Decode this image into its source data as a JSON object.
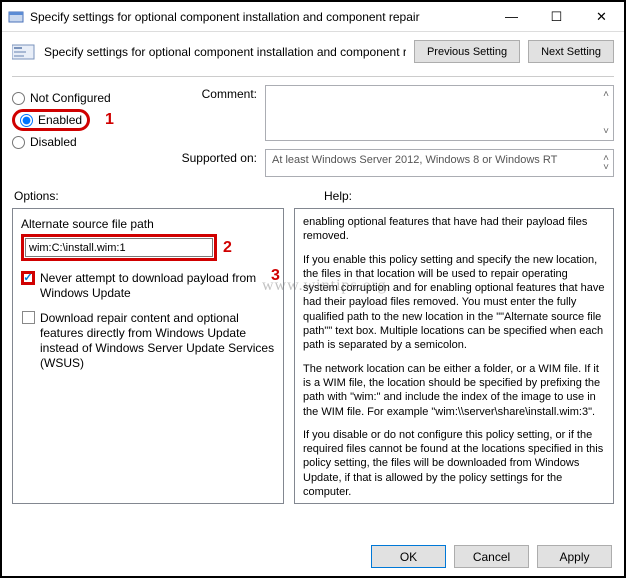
{
  "window": {
    "title": "Specify settings for optional component installation and component repair",
    "minimize": "—",
    "maximize": "☐",
    "close": "✕"
  },
  "header": {
    "text": "Specify settings for optional component installation and component repair",
    "prev": "Previous Setting",
    "next": "Next Setting"
  },
  "radios": {
    "not_configured": "Not Configured",
    "enabled": "Enabled",
    "disabled": "Disabled"
  },
  "fields": {
    "comment_label": "Comment:",
    "supported_label": "Supported on:",
    "supported_value": "At least Windows Server 2012, Windows 8 or Windows RT"
  },
  "labels": {
    "options": "Options:",
    "help": "Help:"
  },
  "annotations": {
    "n1": "1",
    "n2": "2",
    "n3": "3"
  },
  "options": {
    "alt_label": "Alternate source file path",
    "path_value": "wim:C:\\install.wim:1",
    "never_attempt": "Never attempt to download payload from Windows Update",
    "download_repair": "Download repair content and optional features directly from Windows Update instead of Windows Server Update Services (WSUS)"
  },
  "help": {
    "p1": "enabling optional features that have had their payload files removed.",
    "p2": "If you enable this policy setting and specify the new location, the files in that location will be used to repair operating system corruption and for enabling optional features that have had their payload files removed. You must enter the fully qualified path to the new location in the \"\"Alternate source file path\"\" text box. Multiple locations can be specified when each path is separated by a semicolon.",
    "p3": "The network location can be either a folder, or a WIM file. If it is a WIM file, the location should be specified by prefixing the path with \"wim:\" and include the index of the image to use in the WIM file. For example \"wim:\\\\server\\share\\install.wim:3\".",
    "p4": "If you disable or do not configure this policy setting, or if the required files cannot be found at the locations specified in this policy setting, the files will be downloaded from Windows Update, if that is allowed by the policy settings for the computer."
  },
  "buttons": {
    "ok": "OK",
    "cancel": "Cancel",
    "apply": "Apply"
  },
  "watermark": "www.wintips.org"
}
